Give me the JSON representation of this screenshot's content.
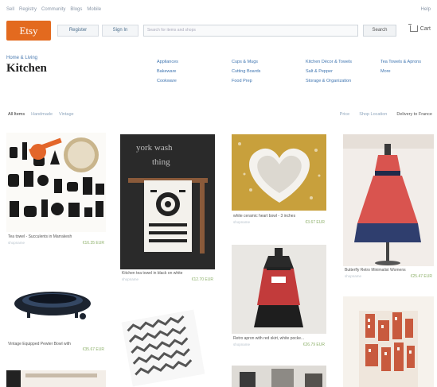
{
  "topnav": {
    "links": [
      "Sell",
      "Registry",
      "Community",
      "Blogs",
      "Mobile"
    ],
    "right": "Help"
  },
  "header": {
    "logo": "Etsy",
    "register": "Register",
    "signin": "Sign In",
    "search_placeholder": "Search for items and shops",
    "search_button": "Search",
    "cart": "Cart"
  },
  "category": {
    "breadcrumb": "Home & Living",
    "title": "Kitchen",
    "subcategories_col1": [
      "Appliances",
      "Bakeware",
      "Cookware"
    ],
    "subcategories_col2": [
      "Cups & Mugs",
      "Cutting Boards",
      "Food Prep"
    ],
    "subcategories_col3": [
      "Kitchen Décor & Towels",
      "Salt & Pepper",
      "Storage & Organization"
    ],
    "subcategories_col4": [
      "Tea Towels & Aprons",
      "More"
    ]
  },
  "filters": {
    "items": [
      "All Items",
      "Handmade",
      "Vintage"
    ],
    "right": [
      "Price",
      "Shop Location",
      "Delivery to France"
    ]
  },
  "listings": [
    {
      "title": "Tea towel - Succulents in Marrakesh",
      "price": "€16.35 EUR"
    },
    {
      "title": "Vintage Equipped Pewter Bowl with",
      "price": "€35.67 EUR"
    },
    {
      "title": "Kitchen tea towel in black on white",
      "price": "€12.70 EUR"
    },
    {
      "title": "white ceramic heart bowl - 3 inches",
      "price": "€3.67 EUR"
    },
    {
      "title": "Retro apron with red skirt, white pocke...",
      "price": "€26.79 EUR"
    },
    {
      "title": "Butterfly Retro Minimalist Womens",
      "price": "€25.47 EUR"
    }
  ],
  "colors": {
    "brand": "#e36a1f",
    "link": "#3e74b0",
    "price": "#8db06a"
  }
}
